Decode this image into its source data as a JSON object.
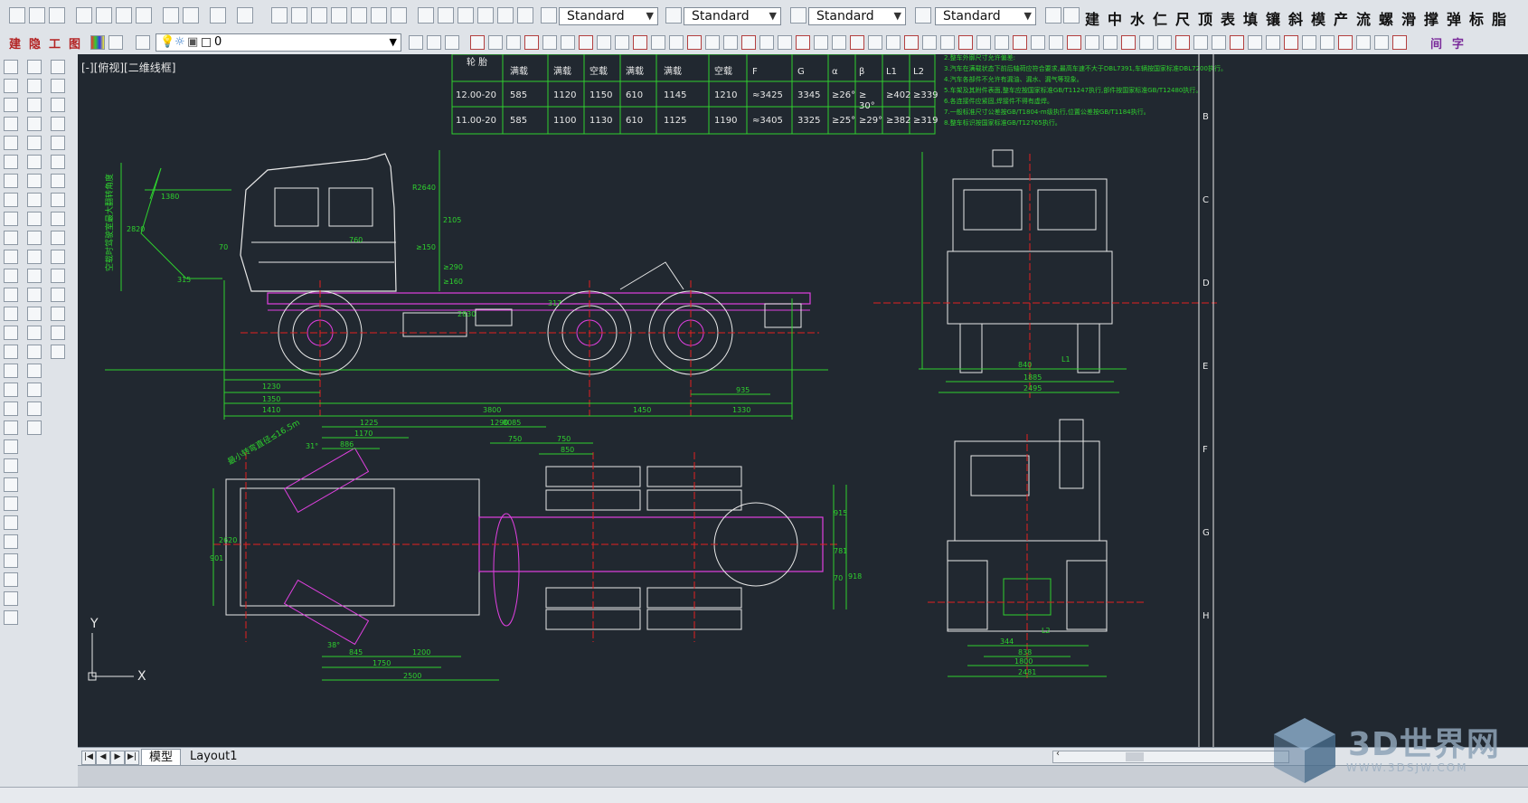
{
  "toolbar_top": {
    "text_style": "Standard",
    "dim_style": "Standard",
    "table_style": "Standard",
    "multileader_style": "Standard",
    "cjk_tools": [
      "建",
      "中",
      "水",
      "仁",
      "尺",
      "顶",
      "表",
      "填",
      "镶",
      "斜",
      "模",
      "产",
      "流",
      "螺",
      "滑",
      "撑",
      "弹",
      "标",
      "脂"
    ]
  },
  "toolbar_second": {
    "layer_name": "0",
    "left_tools": [
      "建",
      "隐",
      "工",
      "图"
    ],
    "right_tools": [
      "间",
      "字"
    ]
  },
  "viewport": {
    "label": "[-][俯视][二维线框]",
    "ucs_x": "X",
    "ucs_y": "Y"
  },
  "table": {
    "header_top": "轮 胎",
    "col_headers": [
      "满载",
      "满载",
      "空载",
      "满载",
      "满载",
      "空载",
      "F",
      "G",
      "α",
      "β",
      "L1",
      "L2"
    ],
    "rows": [
      [
        "12.00-20",
        "585",
        "1120",
        "1150",
        "610",
        "1145",
        "1210",
        "≈3425",
        "3345",
        "≥26°",
        "≥",
        "≥402",
        "≥339"
      ],
      [
        "11.00-20",
        "585",
        "1100",
        "1130",
        "610",
        "1125",
        "1190",
        "≈3405",
        "3325",
        "≥25°",
        "≥29°",
        "≥382",
        "≥319"
      ]
    ],
    "beta_note": "30°"
  },
  "notes": [
    "2.整车外廓尺寸允许偏差:",
    "3.汽车在满载状态下前后轴荷应符合要求,最高车速不大于DBL7391,车辆按国家标准DBL7200执行。",
    "4.汽车各部件不允许有漏油、漏水、漏气等现象。",
    "5.车架及其附件表面,整车应按国家标准GB/T11247执行,部件按国家标准GB/T12480执行。",
    "6.各连接件应紧固,焊接件不得有虚焊。",
    "7.一般标准尺寸公差按GB/T1804-m级执行,位置公差按GB/T1184执行。",
    "8.整车标识按国家标准GB/T12765执行。"
  ],
  "side_view_dims": [
    "1380",
    "2820",
    "760",
    "R2640",
    "2105",
    "≥150",
    "≥290",
    "≥160",
    "70",
    "315",
    "317",
    "2830",
    "1230",
    "1350",
    "1410",
    "3800",
    "1450",
    "935",
    "1330",
    "8085"
  ],
  "side_view_label": "空载时驾驶室最大翻转角度",
  "front_view_dims": [
    "840",
    "1885",
    "2495",
    "L1"
  ],
  "top_view_dims": [
    "1225",
    "1290",
    "1170",
    "886",
    "750",
    "850",
    "750",
    "2620",
    "901",
    "845",
    "1200",
    "1750",
    "2500",
    "915",
    "781",
    "70",
    "918",
    "31°",
    "38°"
  ],
  "top_view_label": "最小转弯直径≤16.5m",
  "rear_view_dims": [
    "344",
    "838",
    "1800",
    "2481",
    "L2"
  ],
  "frame_letters": [
    "B",
    "C",
    "D",
    "E",
    "F",
    "G",
    "H"
  ],
  "tabs": {
    "model": "模型",
    "layout": "Layout1"
  },
  "watermark": {
    "brand": "3D世界网",
    "url": "WWW.3DSJW.COM"
  },
  "colors": {
    "canvas": "#212830",
    "drawing_white": "#e8e8e8",
    "dim_green": "#2ed12e",
    "frame_magenta": "#e040e0",
    "center_red": "#e32020",
    "cyan": "#2ec8e0",
    "toolbar": "#dfe3e8"
  }
}
